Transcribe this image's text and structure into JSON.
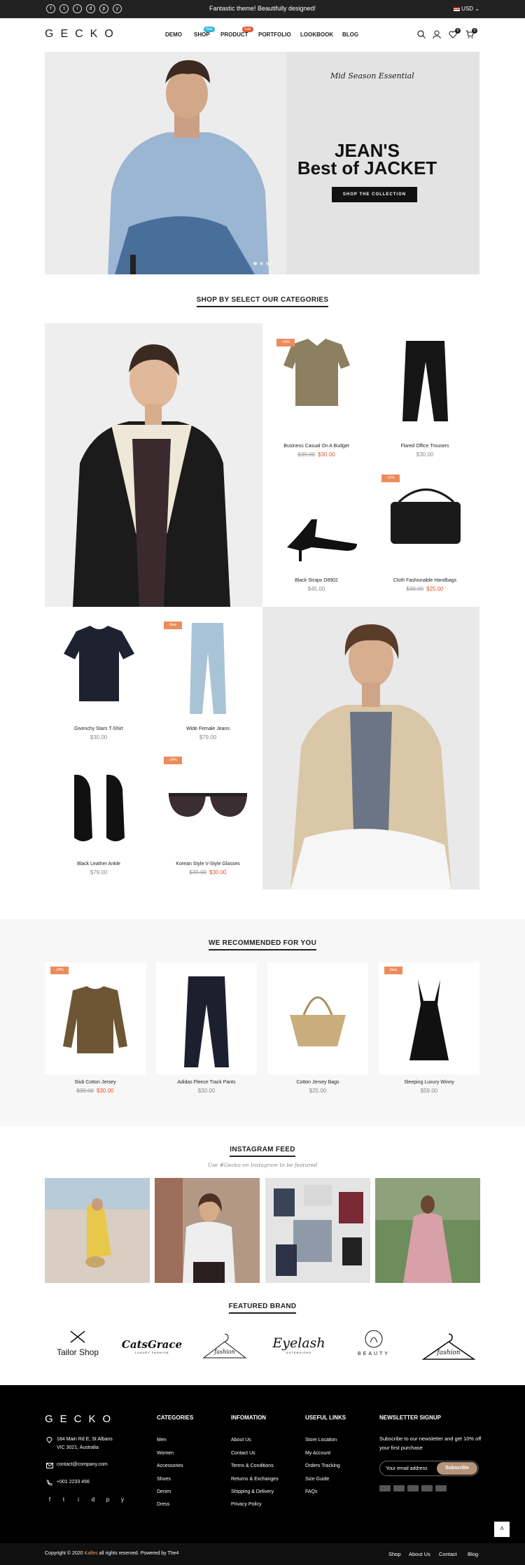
{
  "topbar": {
    "social": [
      "f",
      "t",
      "i",
      "d",
      "p",
      "y"
    ],
    "promo": "Fantastic theme! Beautifully designed!",
    "currency": "USD ⌄"
  },
  "header": {
    "logo": "GECKO",
    "nav": [
      {
        "label": "DEMO"
      },
      {
        "label": "SHOP",
        "badge": "New",
        "badge_color": "#2cb7d1"
      },
      {
        "label": "PRODUCT",
        "badge": "Sale",
        "badge_color": "#e4572e"
      },
      {
        "label": "PORTFOLIO"
      },
      {
        "label": "LOOKBOOK"
      },
      {
        "label": "BLOG"
      }
    ],
    "wishlist_count": "0",
    "cart_count": "0"
  },
  "hero": {
    "subtitle": "Mid Season Essential",
    "title_line1": "JEAN'S",
    "title_line2": "Best of JACKET",
    "button": "SHOP THE COLLECTION"
  },
  "categories": {
    "title": "SHOP BY SELECT OUR CATEGORIES",
    "products": [
      {
        "name": "Business Casual On A Budget",
        "old_price": "$39.00",
        "price": "$30.00",
        "sale": "-24%"
      },
      {
        "name": "Flared Office Trousers",
        "price": "$30.00"
      },
      {
        "name": "Black Straps D8902",
        "price": "$45.00"
      },
      {
        "name": "Cloth Fashionable Handbags",
        "old_price": "$30.00",
        "price": "$25.00",
        "sale": "-17%"
      },
      {
        "name": "Givenchy Stars T-Shirt",
        "price": "$30.00"
      },
      {
        "name": "Wide Female Jeans",
        "price": "$79.00",
        "sale": "New"
      },
      {
        "name": "Black Leather Ankle",
        "price": "$79.00"
      },
      {
        "name": "Korean Style V-Style Glasses",
        "old_price": "$39.00",
        "price": "$30.00",
        "sale": "-24%"
      }
    ]
  },
  "recommended": {
    "title": "WE RECOMMENDED FOR YOU",
    "products": [
      {
        "name": "Slub Cotton Jersey",
        "old_price": "$39.00",
        "price": "$30.00",
        "sale": "-24%"
      },
      {
        "name": "Adidas Fleece Track Pants",
        "price": "$30.00"
      },
      {
        "name": "Cotton Jersey Bags",
        "price": "$25.00"
      },
      {
        "name": "Sleeping Luxury Winny",
        "price": "$59.00",
        "sale": "New"
      }
    ]
  },
  "instagram": {
    "title": "INSTAGRAM FEED",
    "subtitle": "Use #Gecko on Instagram to be featured"
  },
  "brands": {
    "title": "FEATURED BRAND",
    "items": [
      {
        "name": "Tailor Shop"
      },
      {
        "name": "CatsGrace",
        "sub": "LUXURY FASHION"
      },
      {
        "name": "fashion"
      },
      {
        "name": "Eyelash",
        "sub": "EXTENSIONS"
      },
      {
        "name": "BEAUTY"
      },
      {
        "name": "fashion"
      }
    ]
  },
  "footer": {
    "logo": "GECKO",
    "address1": "184 Main Rd E, St Albans",
    "address2": "VIC 3021, Australia",
    "email": "contact@company.com",
    "phone": "+001 2233 456",
    "categories": {
      "title": "CATEGORIES",
      "links": [
        "Men",
        "Women",
        "Accessories",
        "Shoes",
        "Denim",
        "Dress"
      ]
    },
    "information": {
      "title": "INFOMATION",
      "links": [
        "About Us",
        "Contact Us",
        "Terms & Conditions",
        "Returns & Exchanges",
        "Shipping & Delivery",
        "Privacy Policy"
      ]
    },
    "useful": {
      "title": "USEFUL LINKS",
      "links": [
        "Store Location",
        "My Account",
        "Orders Tracking",
        "Size Guide",
        "FAQs"
      ]
    },
    "newsletter": {
      "title": "NEWSLETTER SIGNUP",
      "text": "Subscribe to our newsletter and get 10% off your first purchase",
      "placeholder": "Your email address",
      "button": "Subscribe"
    },
    "social": [
      "f",
      "t",
      "i",
      "d",
      "p",
      "y"
    ],
    "copyright_pre": "Copyright © 2020 ",
    "copyright_brand": "Kalles",
    "copyright_post": " all rights reserved. Powered by The4",
    "bottom_links": [
      "Shop",
      "About Us",
      "Contact",
      "Blog"
    ]
  }
}
